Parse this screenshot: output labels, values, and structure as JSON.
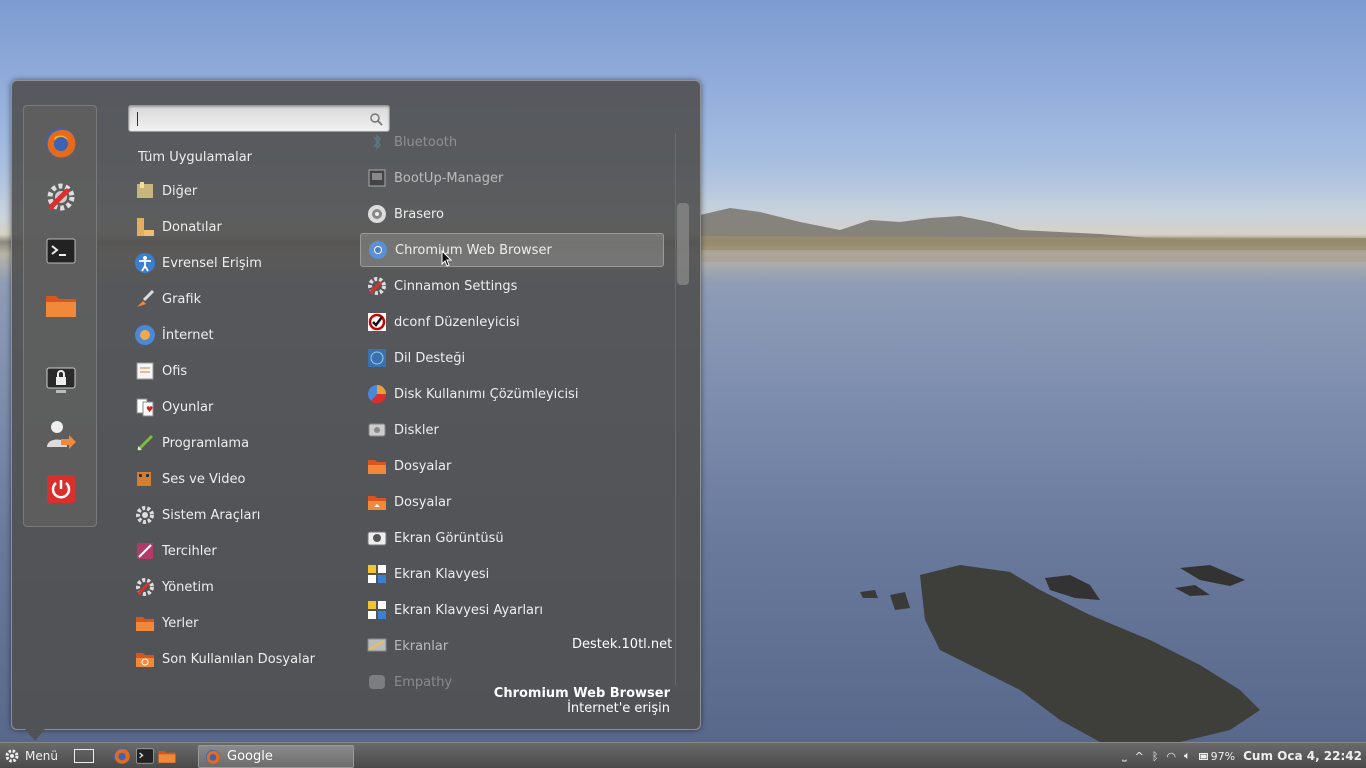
{
  "search": {
    "placeholder": "",
    "value": ""
  },
  "categories_header": "Tüm Uygulamalar",
  "categories": [
    {
      "label": "Diğer",
      "icon": "misc-folder-icon"
    },
    {
      "label": "Donatılar",
      "icon": "accessories-icon"
    },
    {
      "label": "Evrensel Erişim",
      "icon": "accessibility-icon"
    },
    {
      "label": "Grafik",
      "icon": "graphics-icon"
    },
    {
      "label": "İnternet",
      "icon": "internet-icon"
    },
    {
      "label": "Ofis",
      "icon": "office-icon"
    },
    {
      "label": "Oyunlar",
      "icon": "games-icon"
    },
    {
      "label": "Programlama",
      "icon": "programming-icon"
    },
    {
      "label": "Ses ve Video",
      "icon": "multimedia-icon"
    },
    {
      "label": "Sistem Araçları",
      "icon": "system-tools-icon"
    },
    {
      "label": "Tercihler",
      "icon": "preferences-icon"
    },
    {
      "label": "Yönetim",
      "icon": "administration-icon"
    },
    {
      "label": "Yerler",
      "icon": "places-icon"
    },
    {
      "label": "Son Kullanılan Dosyalar",
      "icon": "recent-files-icon"
    }
  ],
  "apps": [
    {
      "label": "Bluetooth",
      "icon": "bluetooth-icon"
    },
    {
      "label": "BootUp-Manager",
      "icon": "bootup-manager-icon"
    },
    {
      "label": "Brasero",
      "icon": "brasero-icon"
    },
    {
      "label": "Chromium Web Browser",
      "icon": "chromium-icon"
    },
    {
      "label": "Cinnamon Settings",
      "icon": "cinnamon-settings-icon"
    },
    {
      "label": "dconf Düzenleyicisi",
      "icon": "dconf-icon"
    },
    {
      "label": "Dil Desteği",
      "icon": "language-support-icon"
    },
    {
      "label": "Disk Kullanımı Çözümleyicisi",
      "icon": "disk-usage-icon"
    },
    {
      "label": "Diskler",
      "icon": "disks-icon"
    },
    {
      "label": "Dosyalar",
      "icon": "files-folder-icon"
    },
    {
      "label": "Dosyalar",
      "icon": "files-home-icon"
    },
    {
      "label": "Ekran Görüntüsü",
      "icon": "screenshot-icon"
    },
    {
      "label": "Ekran Klavyesi",
      "icon": "onscreen-keyboard-icon"
    },
    {
      "label": "Ekran Klavyesi Ayarları",
      "icon": "onscreen-keyboard-settings-icon"
    },
    {
      "label": "Ekranlar",
      "icon": "displays-icon"
    },
    {
      "label": "Empathy",
      "icon": "empathy-icon"
    }
  ],
  "selected_app": {
    "title": "Chromium Web Browser",
    "description": "İnternet'e erişin"
  },
  "watermark": "Destek.10tl.net",
  "favorites": [
    "firefox-icon",
    "settings-icon",
    "terminal-icon",
    "folder-icon",
    "lock-screen-icon",
    "logout-icon",
    "shutdown-icon"
  ],
  "taskbar": {
    "menu_label": "Menü",
    "window_title": "Google",
    "battery": "97%",
    "clock": "Cum Oca  4, 22:42"
  },
  "colors": {
    "menu_bg": "#505050",
    "selected_bg": "#8c8c8c",
    "taskbar_bg": "#5a5a5a"
  }
}
